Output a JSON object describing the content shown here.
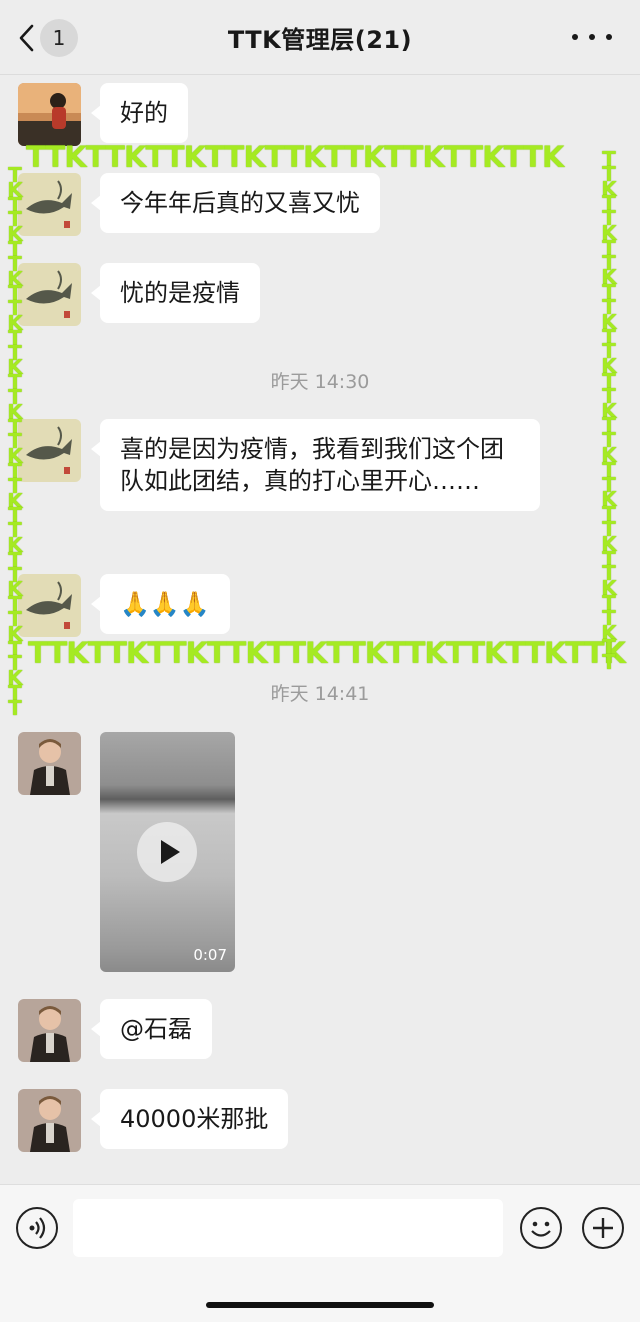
{
  "header": {
    "unread_count": "1",
    "title": "TTK管理层(21)"
  },
  "messages": [
    {
      "text": "好的"
    },
    {
      "text": "今年年后真的又喜又忧"
    },
    {
      "text": "忧的是疫情"
    },
    {
      "text": "喜的是因为疫情，我看到我们这个团队如此团结，真的打心里开心……"
    },
    {
      "text": "🙏🙏🙏"
    },
    {
      "video_duration": "0:07"
    },
    {
      "text": "@石磊"
    },
    {
      "text": "40000米那批"
    }
  ],
  "timestamps": [
    "昨天 14:30",
    "昨天 14:41"
  ],
  "watermark": {
    "top": "TTKTTKTTKTTKTTKTTKTTKTTKTTK",
    "bottom": "TTKTTKTTKTTKTTKTTKTTKTTKTTKTTK",
    "left": "TKTTKTTKTTKTTKTTKTTKTTKTTKTTKTTKTTKTT",
    "right": "TTKTTKTTKTTKTTKTTKTTKTTKTTKTTKTTKTT",
    "color": "#a5ea22"
  },
  "input": {
    "voice_icon": "voice-icon",
    "emoji_icon": "emoji-icon",
    "plus_icon": "plus-icon"
  }
}
